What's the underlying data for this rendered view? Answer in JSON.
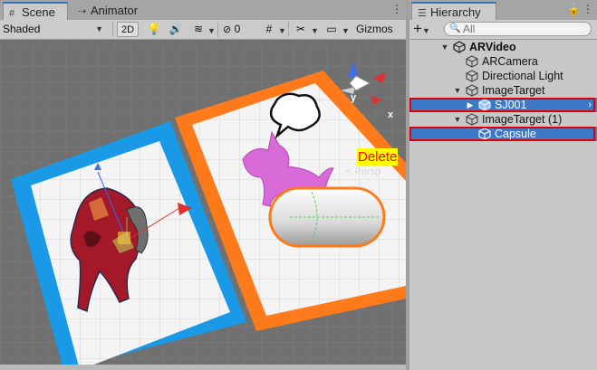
{
  "scene_tabs": {
    "scene_label": "Scene",
    "animator_label": "Animator"
  },
  "scene_toolbar": {
    "draw_mode": "Shaded",
    "mode_2d": "2D",
    "hidden_count": "0",
    "gizmos_label": "Gizmos"
  },
  "scene": {
    "projection_label": "< Persp",
    "gizmo_x": "x",
    "gizmo_y": "y",
    "annotation": "Delete",
    "colors": {
      "left_target_border": "#1a9ae6",
      "right_target_border": "#ff7a1a",
      "card_fill": "#f4f4f4",
      "selection_outline": "#e00000",
      "hierarchy_selection": "#3d79c6"
    }
  },
  "hierarchy": {
    "tab_label": "Hierarchy",
    "add_symbol": "+",
    "search_placeholder": "All",
    "items": [
      {
        "label": "ARVideo",
        "icon": "unity-scene-icon"
      },
      {
        "label": "ARCamera",
        "icon": "gameobject-cube-icon"
      },
      {
        "label": "Directional Light",
        "icon": "gameobject-cube-icon"
      },
      {
        "label": "ImageTarget",
        "icon": "gameobject-cube-icon"
      },
      {
        "label": "SJ001",
        "icon": "prefab-cube-icon"
      },
      {
        "label": "ImageTarget (1)",
        "icon": "gameobject-cube-icon"
      },
      {
        "label": "Capsule",
        "icon": "gameobject-cube-icon"
      }
    ]
  }
}
